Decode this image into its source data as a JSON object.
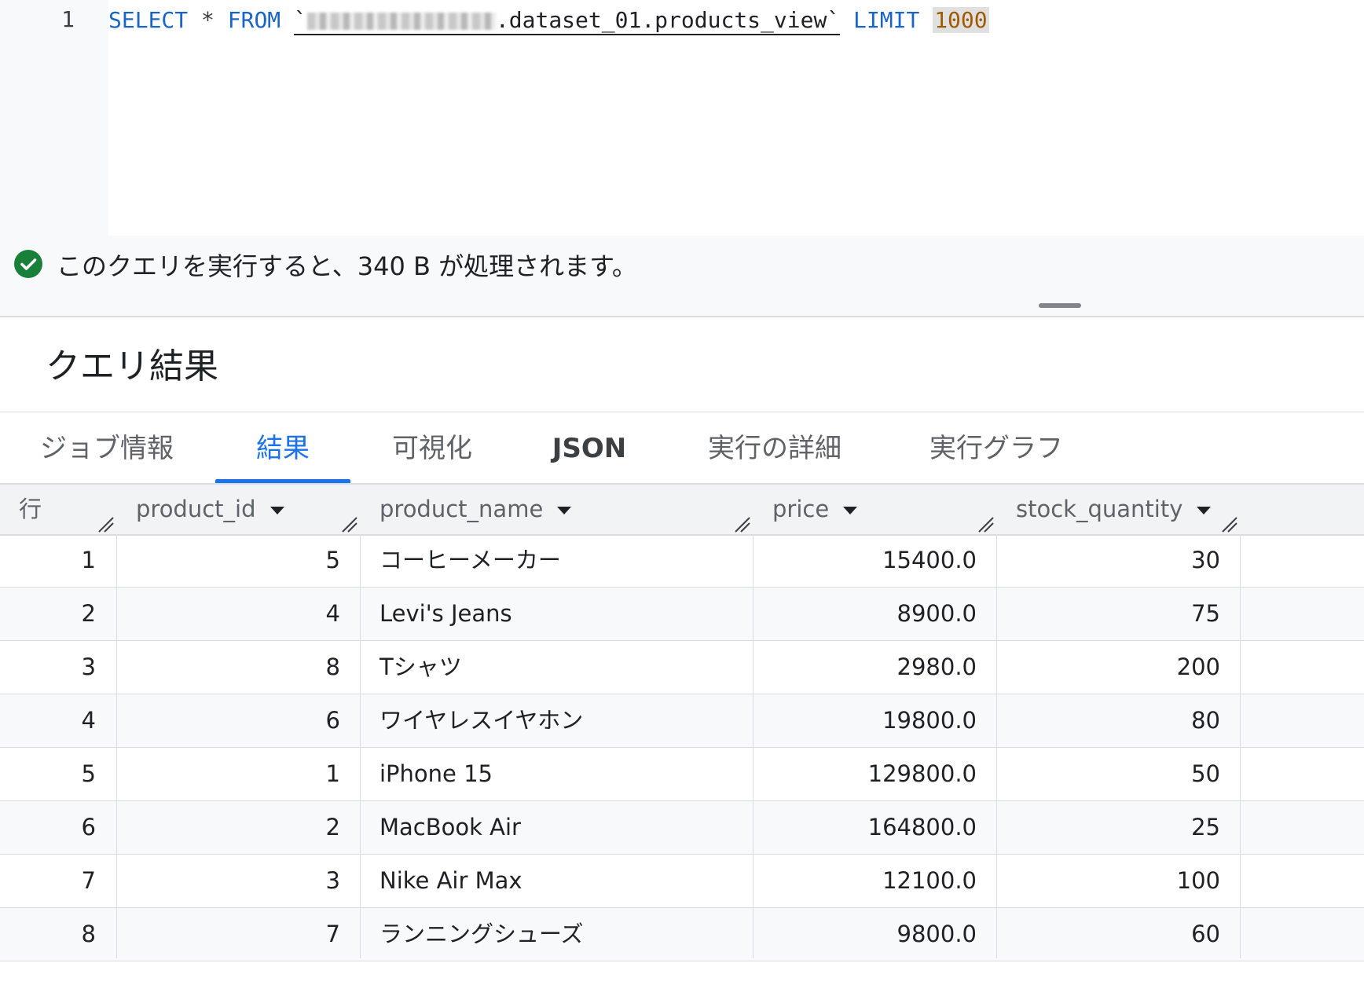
{
  "editor": {
    "line_number": "1",
    "code": {
      "select": "SELECT",
      "star": "*",
      "from": "FROM",
      "table_open": "`",
      "table_suffix": ".dataset_01.products_view",
      "table_close": "`",
      "limit": "LIMIT",
      "limit_value": "1000"
    }
  },
  "status": {
    "icon": "check-circle-icon",
    "icon_color": "#188038",
    "message": "このクエリを実行すると、340 B が処理されます。"
  },
  "results": {
    "title": "クエリ結果",
    "tabs": [
      {
        "label": "ジョブ情報"
      },
      {
        "label": "結果",
        "active": true
      },
      {
        "label": "可視化"
      },
      {
        "label": "JSON"
      },
      {
        "label": "実行の詳細"
      },
      {
        "label": "実行グラフ"
      }
    ],
    "accent_color": "#1a73e8"
  },
  "table": {
    "columns": [
      "行",
      "product_id",
      "product_name",
      "price",
      "stock_quantity"
    ],
    "rows": [
      [
        "1",
        "5",
        "コーヒーメーカー",
        "15400.0",
        "30"
      ],
      [
        "2",
        "4",
        "Levi's Jeans",
        "8900.0",
        "75"
      ],
      [
        "3",
        "8",
        "Tシャツ",
        "2980.0",
        "200"
      ],
      [
        "4",
        "6",
        "ワイヤレスイヤホン",
        "19800.0",
        "80"
      ],
      [
        "5",
        "1",
        "iPhone 15",
        "129800.0",
        "50"
      ],
      [
        "6",
        "2",
        "MacBook Air",
        "164800.0",
        "25"
      ],
      [
        "7",
        "3",
        "Nike Air Max",
        "12100.0",
        "100"
      ],
      [
        "8",
        "7",
        "ランニングシューズ",
        "9800.0",
        "60"
      ]
    ]
  }
}
